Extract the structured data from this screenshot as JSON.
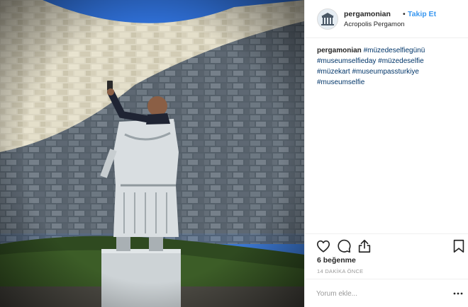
{
  "colors": {
    "link": "#3897f0",
    "hashtag": "#003569",
    "text": "#262626",
    "muted": "#999999",
    "divider": "#efefef"
  },
  "post": {
    "photo_icon": "statue-selfie-photo"
  },
  "header": {
    "username": "pergamonian",
    "separator": "•",
    "follow_label": "Takip Et",
    "location": "Acropolis Pergamon",
    "avatar_icon": "temple-avatar-icon"
  },
  "caption": {
    "username": "pergamonian",
    "hashtags": [
      "#müzedeselfiegünü",
      "#museumselfieday",
      "#müzedeselfie",
      "#müzekart",
      "#museumpassturkiye",
      "#museumselfie"
    ]
  },
  "actions": {
    "icons": [
      "heart-icon",
      "comment-icon",
      "share-icon",
      "bookmark-icon"
    ]
  },
  "likes": "6 beğenme",
  "timestamp": "14 DAKİKA ÖNCE",
  "add_comment": {
    "placeholder": "Yorum ekle...",
    "more_icon": "more-options-icon"
  }
}
